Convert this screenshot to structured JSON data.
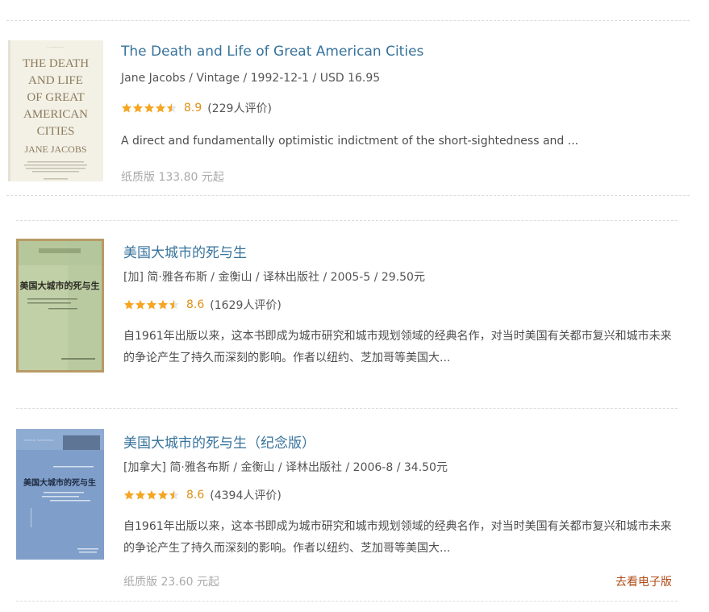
{
  "books": [
    {
      "title": "The Death and Life of Great American Cities",
      "meta": "Jane Jacobs / Vintage / 1992-12-1 / USD 16.95",
      "rating": {
        "stars": 4.5,
        "score": "8.9",
        "count": "(229人评价)"
      },
      "desc": "A direct and fundamentally optimistic indictment of the short-sightedness and ...",
      "price": "纸质版 133.80 元起",
      "cover": {
        "lines": [
          "THE DEATH",
          "AND LIFE",
          "OF GREAT",
          "AMERICAN",
          "CITIES"
        ],
        "author": "JANE JACOBS",
        "bg": "#f3f1e6"
      }
    },
    {
      "title": "美国大城市的死与生",
      "meta": "[加] 简·雅各布斯 / 金衡山 / 译林出版社 / 2005-5 / 29.50元",
      "rating": {
        "stars": 4.5,
        "score": "8.6",
        "count": "(1629人评价)"
      },
      "desc": "自1961年出版以来，这本书即成为城市研究和城市规划领域的经典名作，对当时美国有关都市复兴和城市未来的争论产生了持久而深刻的影响。作者以纽约、芝加哥等美国大...",
      "cover": {
        "text": "美国大城市的死与生",
        "bg": "#c2d0a8"
      }
    },
    {
      "title": "美国大城市的死与生（纪念版）",
      "meta": "[加拿大] 简·雅各布斯 / 金衡山 / 译林出版社 / 2006-8 / 34.50元",
      "rating": {
        "stars": 4.5,
        "score": "8.6",
        "count": "(4394人评价)"
      },
      "desc": "自1961年出版以来，这本书即成为城市研究和城市规划领域的经典名作，对当时美国有关都市复兴和城市未来的争论产生了持久而深刻的影响。作者以纽约、芝加哥等美国大...",
      "price": "纸质版 23.60 元起",
      "ebook_link": "去看电子版",
      "cover": {
        "text": "美国大城市的死与生",
        "bg": "#7f9fca"
      }
    }
  ],
  "colors": {
    "title": "#37739c",
    "star": "#f5a623",
    "score": "#e09015",
    "ebook": "#b04a14",
    "price": "#aaaaaa"
  },
  "icons": {
    "star": "star-icon"
  }
}
